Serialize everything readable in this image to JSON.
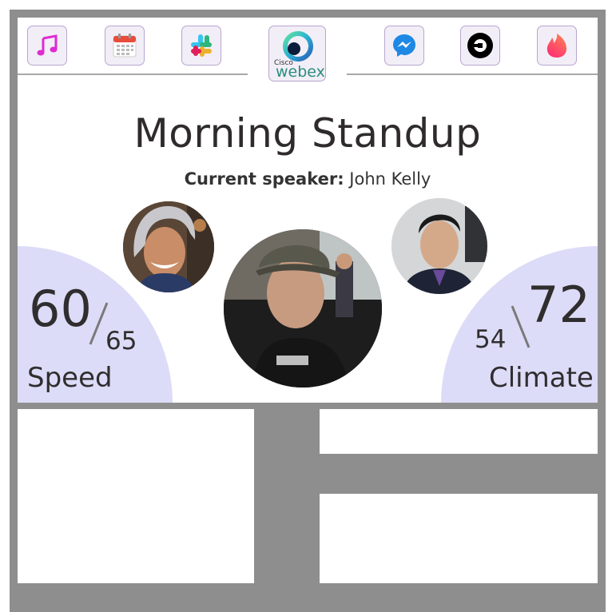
{
  "apps": [
    {
      "name": "music",
      "icon": "music-note-icon"
    },
    {
      "name": "calendar",
      "icon": "calendar-icon"
    },
    {
      "name": "slack",
      "icon": "slack-icon"
    },
    {
      "name": "webex",
      "icon": "webex-icon",
      "brand_small": "Cisco",
      "brand": "webex"
    },
    {
      "name": "messenger",
      "icon": "messenger-icon"
    },
    {
      "name": "uber",
      "icon": "uber-icon"
    },
    {
      "name": "tinder",
      "icon": "tinder-flame-icon"
    }
  ],
  "meeting": {
    "title": "Morning Standup",
    "speaker_label": "Current speaker:",
    "speaker_name": "John Kelly"
  },
  "speed": {
    "current": "60",
    "limit": "65",
    "label": "Speed"
  },
  "climate": {
    "set": "72",
    "current": "54",
    "label": "Climate"
  },
  "participants": [
    {
      "name": "participant-left"
    },
    {
      "name": "participant-center-speaker"
    },
    {
      "name": "participant-right"
    }
  ],
  "colors": {
    "gauge_fill": "#dcdcf8",
    "chrome_gray": "#8e8e8e",
    "icon_border": "#b7a6cf",
    "icon_bg": "#f2eef7"
  }
}
